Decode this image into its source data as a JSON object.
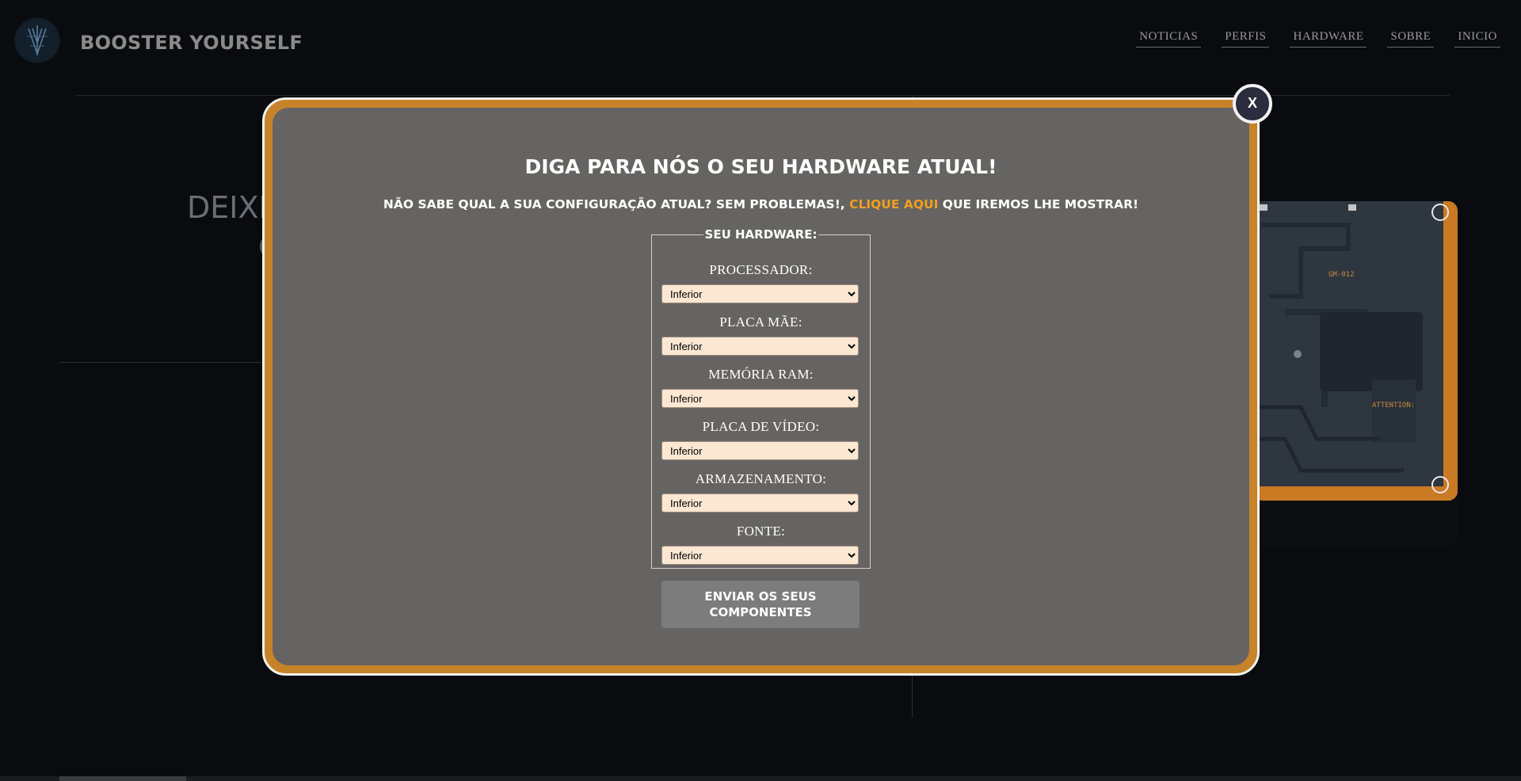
{
  "header": {
    "brand": "BOOSTER YOURSELF",
    "nav": [
      "NOTICIAS",
      "PERFIS",
      "HARDWARE",
      "SOBRE",
      "INICIO"
    ]
  },
  "background": {
    "title_fragment": "DEIXE"
  },
  "modal": {
    "close_label": "X",
    "title": "DIGA PARA NÓS O SEU HARDWARE ATUAL!",
    "subtitle_before": "NÃO SABE QUAL A SUA CONFIGURAÇÃO ATUAL? SEM PROBLEMAS!, ",
    "subtitle_link": "CLIQUE AQUI",
    "subtitle_after": " QUE IREMOS LHE MOSTRAR!",
    "fieldset_legend": "SEU HARDWARE:",
    "fields": [
      {
        "label": "PROCESSADOR:",
        "selected": "Inferior"
      },
      {
        "label": "PLACA MÃE:",
        "selected": "Inferior"
      },
      {
        "label": "MEMÓRIA RAM:",
        "selected": "Inferior"
      },
      {
        "label": "PLACA DE VÍDEO:",
        "selected": "Inferior"
      },
      {
        "label": "ARMAZENAMENTO:",
        "selected": "Inferior"
      },
      {
        "label": "FONTE:",
        "selected": "Inferior"
      }
    ],
    "submit_label": "ENVIAR OS SEUS COMPONENTES"
  },
  "colors": {
    "modal_border": "#c7832a",
    "modal_body": "#666462",
    "link": "#f0a020",
    "select_bg": "#fbe7d2"
  },
  "board_text": {
    "label1": "GM-012",
    "label2": "ATTENTION:"
  }
}
